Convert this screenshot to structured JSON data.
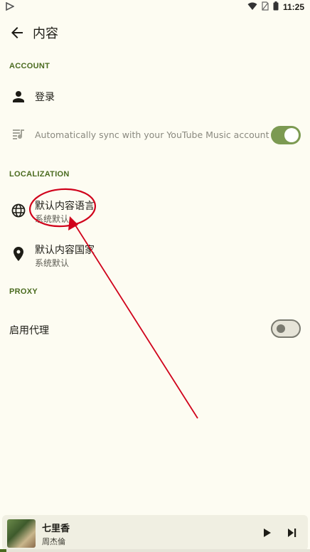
{
  "statusbar": {
    "time": "11:25"
  },
  "topbar": {
    "title": "内容"
  },
  "account": {
    "header": "ACCOUNT",
    "login_label": "登录",
    "sync_label": "Automatically sync with your YouTube Music account",
    "sync_enabled": true
  },
  "localization": {
    "header": "LOCALIZATION",
    "language_label": "默认内容语言",
    "language_value": "系统默认",
    "country_label": "默认内容国家",
    "country_value": "系统默认"
  },
  "proxy": {
    "header": "PROXY",
    "enable_label": "启用代理",
    "enabled": false
  },
  "player": {
    "song": "七里香",
    "artist": "周杰倫",
    "progress": 0.02
  },
  "colors": {
    "background": "#fdfcf2",
    "accent": "#4a6b1f",
    "annotation": "#d0021b"
  },
  "icons": [
    "play-store-icon",
    "wifi-icon",
    "sim-icon",
    "battery-icon",
    "back-arrow-icon",
    "person-icon",
    "music-sync-icon",
    "globe-icon",
    "location-pin-icon",
    "play-icon",
    "skip-next-icon"
  ]
}
